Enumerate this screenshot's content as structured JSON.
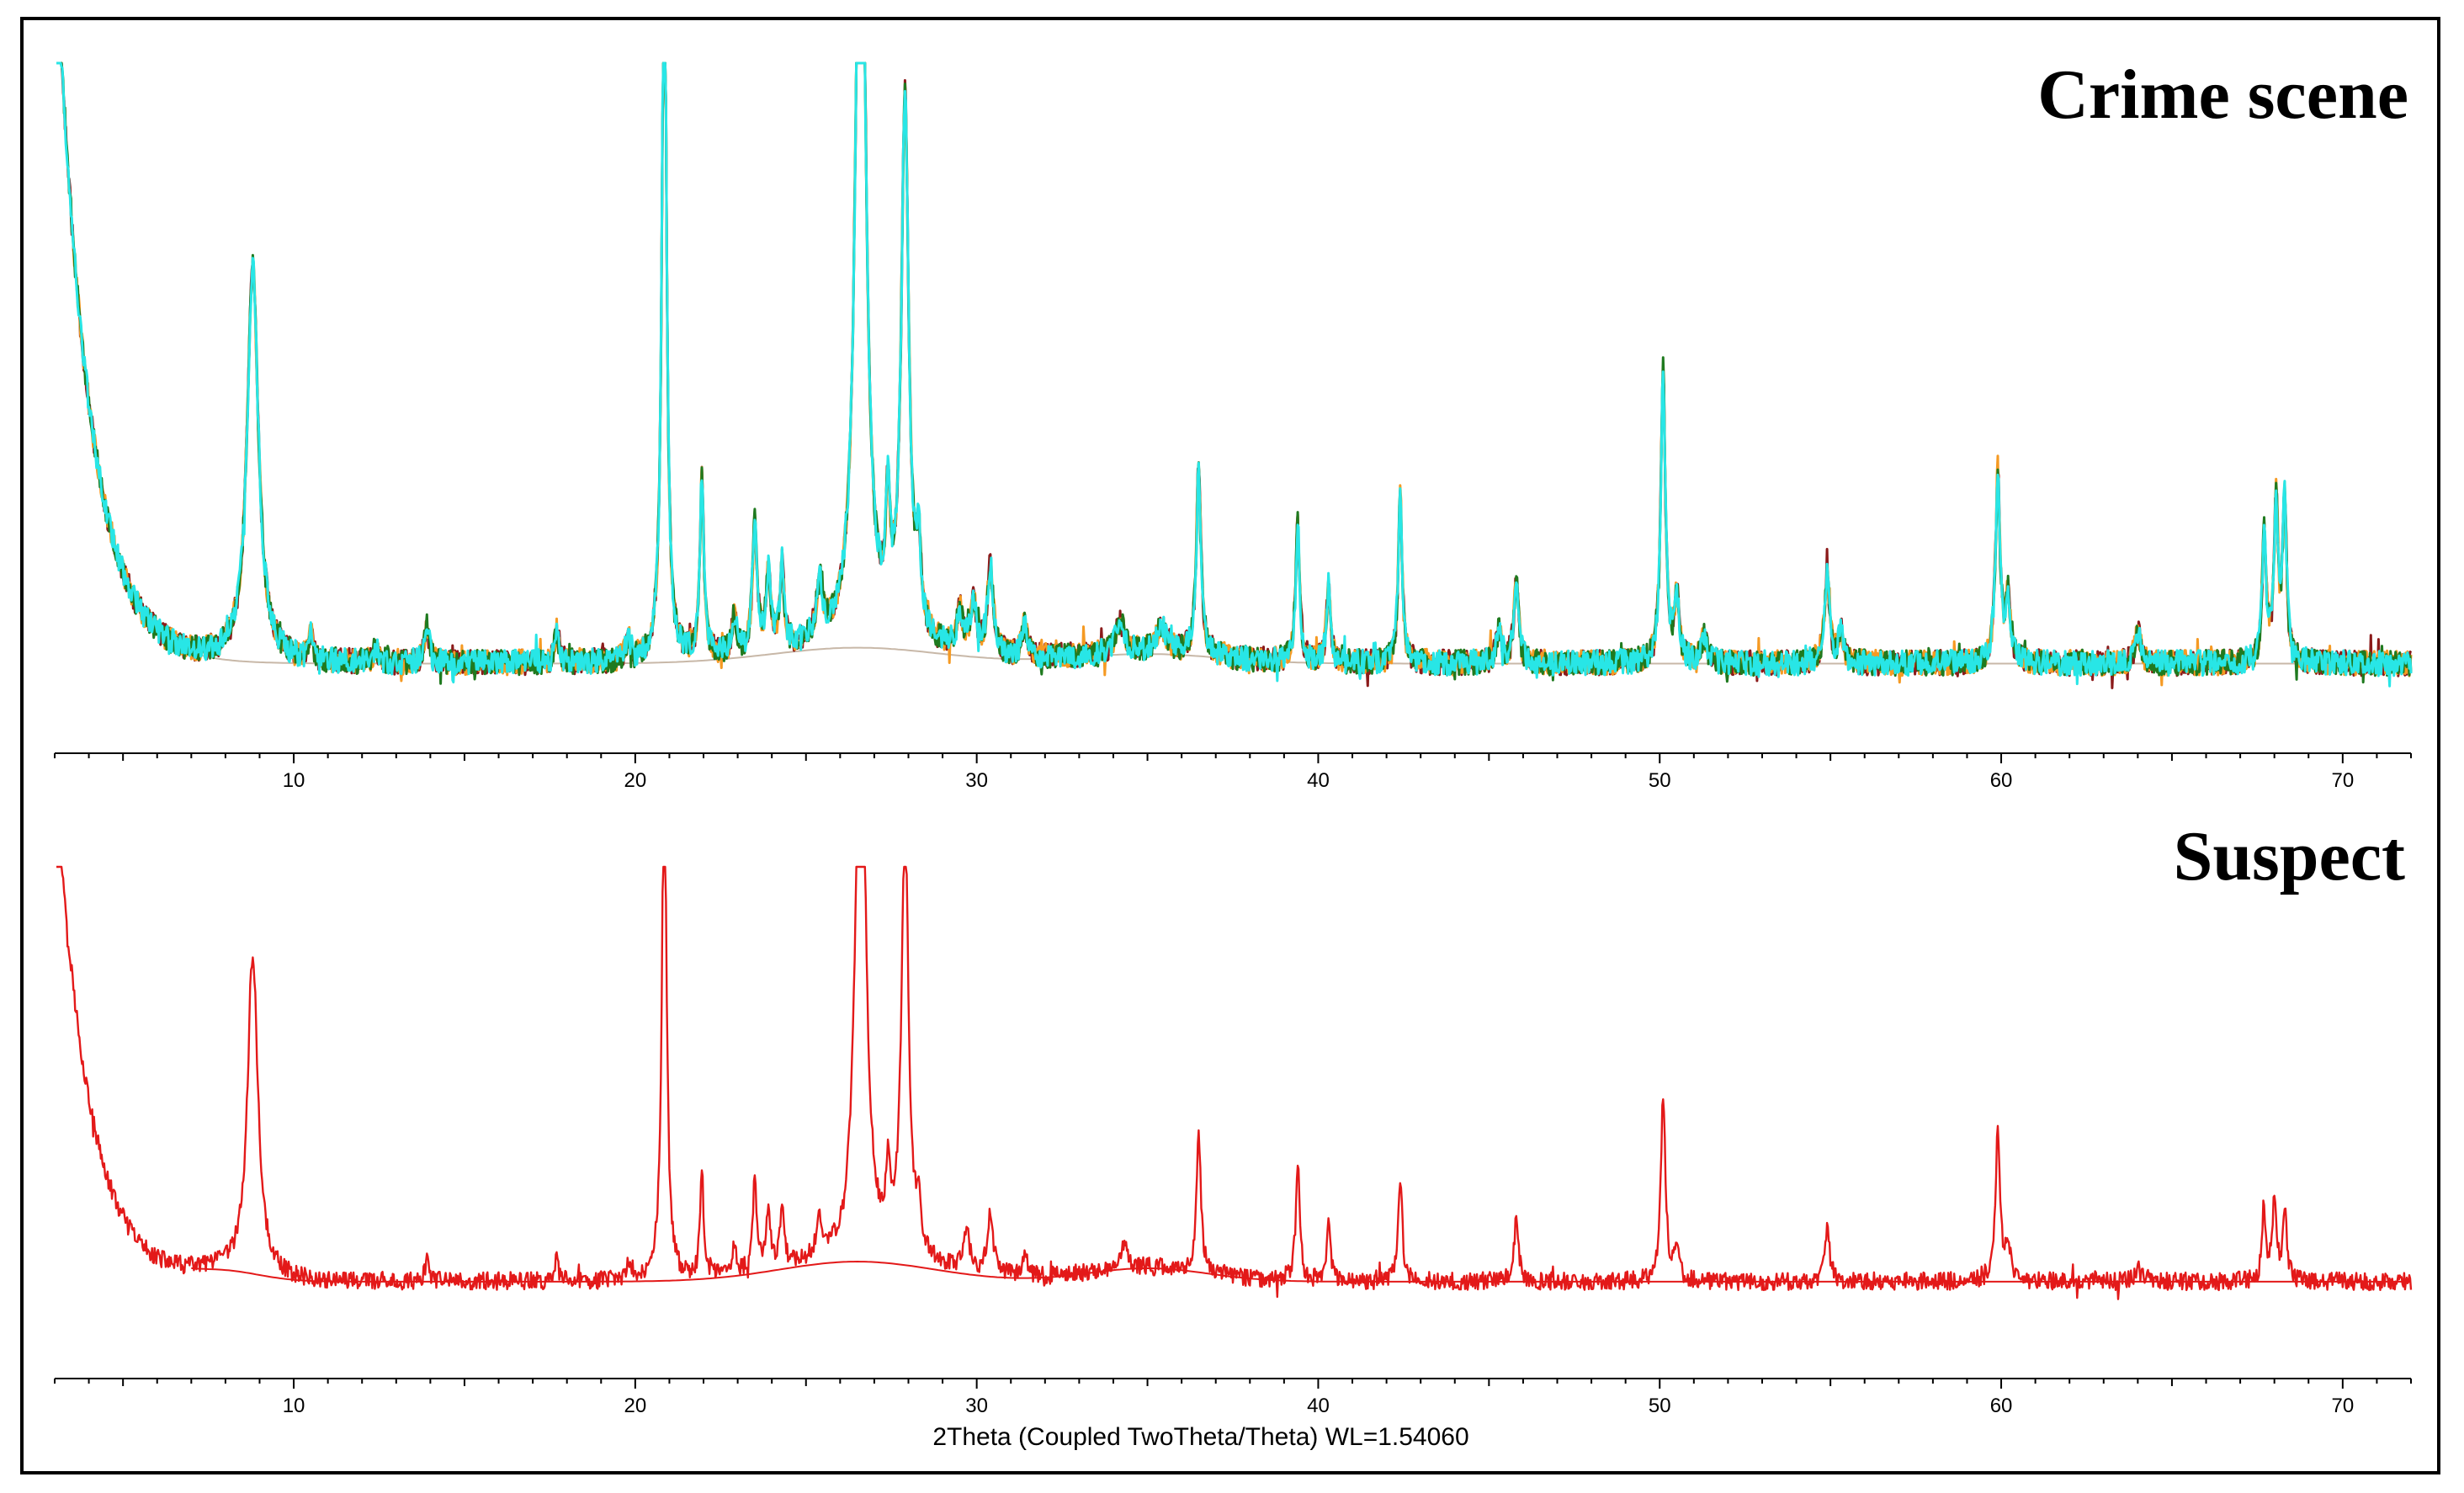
{
  "chart_data": [
    {
      "type": "line",
      "title": "Crime scene",
      "xlabel": "",
      "ylabel": "",
      "xlim": [
        3,
        72
      ],
      "ylim": [
        0,
        1
      ],
      "xticks": [
        10,
        20,
        30,
        40,
        50,
        60,
        70
      ],
      "grid": false,
      "colors": [
        "#8b1a1a",
        "#f59a23",
        "#1f7a1f",
        "#28e6e6"
      ],
      "baseline_color": "#c8b8a8",
      "background": {
        "level": 0.055,
        "decay_level": 0.95,
        "decay_rate": 0.95,
        "humps": [
          [
            26.5,
            0.025,
            3.5
          ],
          [
            35,
            0.015,
            3
          ]
        ]
      },
      "peaks": [
        [
          8.8,
          0.62,
          0.2
        ],
        [
          10.5,
          0.05,
          0.05
        ],
        [
          12.4,
          0.02,
          0.1
        ],
        [
          13.9,
          0.06,
          0.08
        ],
        [
          17.7,
          0.05,
          0.07
        ],
        [
          19.8,
          0.03,
          0.1
        ],
        [
          20.85,
          1.2,
          0.08
        ],
        [
          21.95,
          0.28,
          0.07
        ],
        [
          22.9,
          0.06,
          0.08
        ],
        [
          23.5,
          0.2,
          0.08
        ],
        [
          23.9,
          0.12,
          0.08
        ],
        [
          24.3,
          0.13,
          0.07
        ],
        [
          25.4,
          0.09,
          0.1
        ],
        [
          26.6,
          1.5,
          0.16
        ],
        [
          27.4,
          0.18,
          0.07
        ],
        [
          27.9,
          0.85,
          0.13
        ],
        [
          28.3,
          0.12,
          0.08
        ],
        [
          29.5,
          0.06,
          0.1
        ],
        [
          29.9,
          0.08,
          0.1
        ],
        [
          30.4,
          0.14,
          0.1
        ],
        [
          31.4,
          0.05,
          0.1
        ],
        [
          34.2,
          0.05,
          0.15
        ],
        [
          35.4,
          0.04,
          0.2
        ],
        [
          36.5,
          0.3,
          0.08
        ],
        [
          39.4,
          0.22,
          0.07
        ],
        [
          40.3,
          0.12,
          0.07
        ],
        [
          42.4,
          0.26,
          0.07
        ],
        [
          45.8,
          0.13,
          0.08
        ],
        [
          45.3,
          0.05,
          0.1
        ],
        [
          50.1,
          0.46,
          0.08
        ],
        [
          50.5,
          0.1,
          0.08
        ],
        [
          51.3,
          0.04,
          0.1
        ],
        [
          54.9,
          0.14,
          0.09
        ],
        [
          55.3,
          0.05,
          0.08
        ],
        [
          59.9,
          0.3,
          0.08
        ],
        [
          60.2,
          0.1,
          0.08
        ],
        [
          64.0,
          0.05,
          0.1
        ],
        [
          67.7,
          0.2,
          0.07
        ],
        [
          68.05,
          0.25,
          0.07
        ],
        [
          68.3,
          0.25,
          0.07
        ]
      ]
    },
    {
      "type": "line",
      "title": "Suspect",
      "xlabel": "2Theta (Coupled TwoTheta/Theta) WL=1.54060",
      "ylabel": "",
      "xlim": [
        3,
        72
      ],
      "ylim": [
        0,
        1
      ],
      "xticks": [
        10,
        20,
        30,
        40,
        50,
        60,
        70
      ],
      "grid": false,
      "colors": [
        "#e31919"
      ],
      "baseline_color": "#e31919",
      "background": {
        "level": 0.07,
        "decay_level": 0.95,
        "decay_rate": 0.95,
        "humps": [
          [
            26.5,
            0.045,
            3.2
          ],
          [
            35,
            0.03,
            2.5
          ],
          [
            8,
            0.02,
            1.5
          ]
        ]
      },
      "peaks": [
        [
          8.8,
          0.72,
          0.18
        ],
        [
          13.9,
          0.05,
          0.06
        ],
        [
          17.7,
          0.05,
          0.06
        ],
        [
          19.8,
          0.03,
          0.08
        ],
        [
          20.85,
          1.2,
          0.08
        ],
        [
          21.95,
          0.24,
          0.06
        ],
        [
          22.9,
          0.06,
          0.07
        ],
        [
          23.5,
          0.2,
          0.07
        ],
        [
          23.9,
          0.13,
          0.07
        ],
        [
          24.3,
          0.14,
          0.07
        ],
        [
          25.4,
          0.08,
          0.1
        ],
        [
          26.6,
          1.5,
          0.16
        ],
        [
          27.4,
          0.15,
          0.07
        ],
        [
          27.9,
          1.0,
          0.12
        ],
        [
          28.3,
          0.1,
          0.08
        ],
        [
          29.7,
          0.1,
          0.1
        ],
        [
          30.4,
          0.14,
          0.1
        ],
        [
          31.4,
          0.05,
          0.1
        ],
        [
          34.3,
          0.05,
          0.15
        ],
        [
          36.5,
          0.3,
          0.08
        ],
        [
          39.4,
          0.26,
          0.07
        ],
        [
          40.3,
          0.13,
          0.07
        ],
        [
          42.4,
          0.24,
          0.07
        ],
        [
          45.8,
          0.14,
          0.08
        ],
        [
          50.1,
          0.42,
          0.08
        ],
        [
          50.5,
          0.08,
          0.08
        ],
        [
          54.9,
          0.12,
          0.09
        ],
        [
          59.9,
          0.34,
          0.08
        ],
        [
          60.2,
          0.08,
          0.08
        ],
        [
          64.0,
          0.03,
          0.1
        ],
        [
          67.7,
          0.15,
          0.07
        ],
        [
          68.0,
          0.18,
          0.07
        ],
        [
          68.3,
          0.16,
          0.07
        ]
      ]
    }
  ]
}
